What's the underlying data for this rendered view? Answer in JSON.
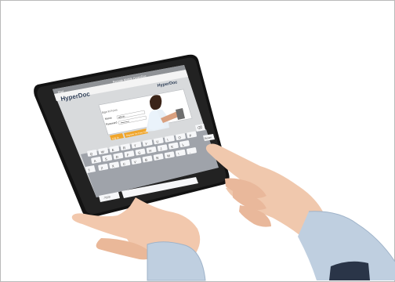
{
  "photo": {
    "subject": "tablet-held-in-hands"
  },
  "screen": {
    "status_bar": {
      "carrier": "iPad",
      "title": "Remote Mobile HyperDoc"
    },
    "app": {
      "brand_left": "HyperDoc",
      "brand_right": "HyperDoc",
      "form": {
        "section_label": "Sign In Form",
        "username_label": "Name",
        "username_value": "admin",
        "password_label": "Password",
        "password_value": "••••••••••",
        "login_button": "Log In",
        "register_button": "Register for Free Trial"
      }
    },
    "keyboard": {
      "rows": [
        [
          "Q",
          "W",
          "E",
          "R",
          "T",
          "Y",
          "U",
          "I",
          "O",
          "P"
        ],
        [
          "A",
          "S",
          "D",
          "F",
          "G",
          "H",
          "J",
          "K",
          "L"
        ],
        [
          "Z",
          "X",
          "C",
          "V",
          "B",
          "N",
          "M",
          "!",
          ","
        ]
      ],
      "return_label": "Return",
      "numbers_label": ".?123",
      "backspace_icon": "backspace-icon",
      "shift_icon": "shift-icon"
    }
  },
  "colors": {
    "device_frame": "#121212",
    "screen_bg": "#d8dadc",
    "keyboard_bg": "#9fa3aa",
    "key": "#f6f7f9",
    "button_orange": "#f0a52a",
    "shirt": "#b8c9dc",
    "skin": "#f0c8ad"
  }
}
